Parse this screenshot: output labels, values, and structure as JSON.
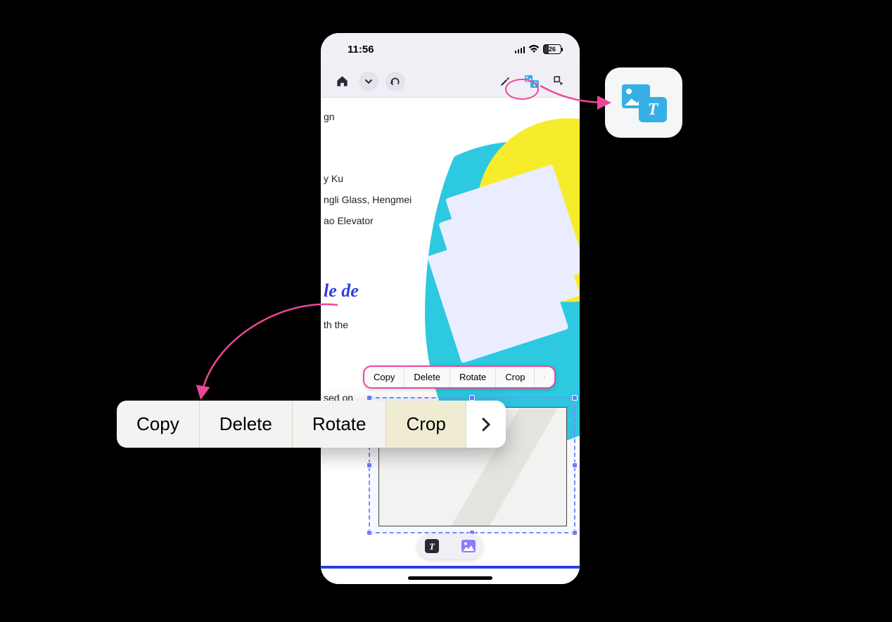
{
  "statusbar": {
    "time": "11:56",
    "battery_percent": "26"
  },
  "toolbar": {
    "home_icon": "home-icon",
    "dropdown_icon": "chevron-down-icon",
    "redo_icon": "redo-icon",
    "highlighter_icon": "highlighter-icon",
    "addcontent_icon": "image-text-icon",
    "lasso_icon": "lasso-select-icon"
  },
  "document": {
    "line1": "gn",
    "line2": "y Ku",
    "line3": "ngli Glass, Hengmei",
    "line4": "ao Elevator",
    "heading_fragment": "le de",
    "body1": "th the",
    "body2": "sed on"
  },
  "context_menu": {
    "items": [
      "Copy",
      "Delete",
      "Rotate",
      "Crop"
    ],
    "more_icon": "chevron-right-icon"
  },
  "mode_bar": {
    "text_mode_icon": "text-mode-icon",
    "image_mode_icon": "image-mode-icon"
  }
}
